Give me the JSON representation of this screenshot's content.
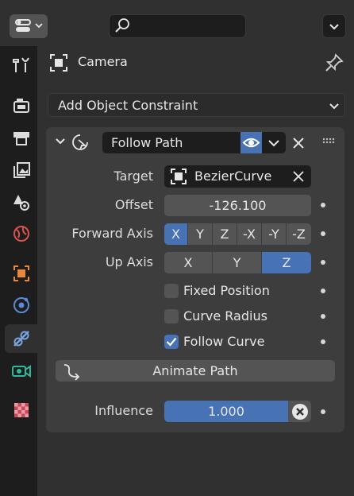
{
  "header": {
    "editor_type_icon": "properties-editor-icon",
    "search_placeholder": "",
    "options_icon": "chevron-down-icon"
  },
  "tabs": [
    {
      "name": "tool",
      "icon": "wrench-screwdriver-icon"
    },
    {
      "name": "render",
      "icon": "camera-back-icon"
    },
    {
      "name": "output",
      "icon": "printer-icon"
    },
    {
      "name": "view-layer",
      "icon": "images-icon"
    },
    {
      "name": "scene",
      "icon": "cone-sphere-icon"
    },
    {
      "name": "world",
      "icon": "globe-icon"
    },
    {
      "name": "object",
      "icon": "object-square-icon"
    },
    {
      "name": "physics",
      "icon": "orbit-icon"
    },
    {
      "name": "object-constraints",
      "icon": "constraint-icon",
      "active": true
    },
    {
      "name": "object-data",
      "icon": "camera-data-icon"
    },
    {
      "name": "texture",
      "icon": "checker-icon"
    }
  ],
  "context": {
    "object_name": "Camera"
  },
  "add_constraint": {
    "label": "Add Object Constraint"
  },
  "constraint": {
    "name": "Follow Path",
    "target_label": "Target",
    "target_value": "BezierCurve",
    "offset_label": "Offset",
    "offset_value": "-126.100",
    "forward_axis_label": "Forward Axis",
    "forward_axis_options": [
      "X",
      "Y",
      "Z",
      "-X",
      "-Y",
      "-Z"
    ],
    "forward_axis_selected": "X",
    "up_axis_label": "Up Axis",
    "up_axis_options": [
      "X",
      "Y",
      "Z"
    ],
    "up_axis_selected": "Z",
    "fixed_position_label": "Fixed Position",
    "fixed_position_checked": false,
    "curve_radius_label": "Curve Radius",
    "curve_radius_checked": false,
    "follow_curve_label": "Follow Curve",
    "follow_curve_checked": true,
    "animate_path_label": "Animate Path",
    "influence_label": "Influence",
    "influence_value": "1.000"
  },
  "colors": {
    "accent": "#4772b3",
    "panel": "#3d3d3d",
    "background": "#303030",
    "tabstrip": "#1d1d1d"
  }
}
